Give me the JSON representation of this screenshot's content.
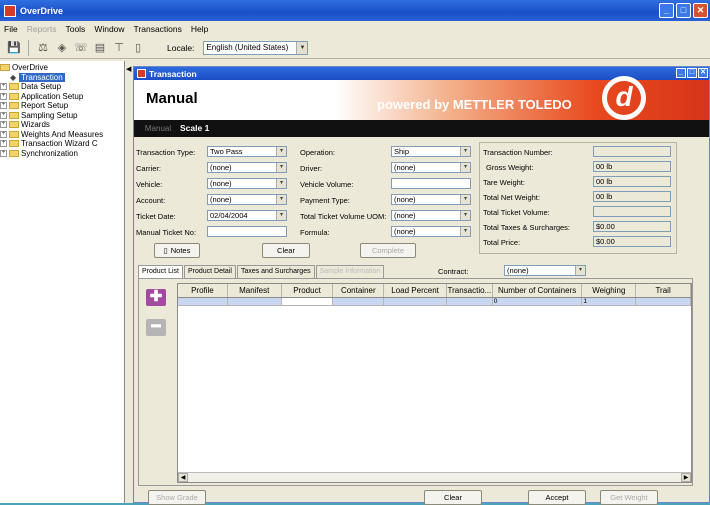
{
  "app": {
    "title": "OverDrive"
  },
  "menu": [
    "File",
    "Reports",
    "Tools",
    "Window",
    "Transactions",
    "Help"
  ],
  "locale": {
    "label": "Locale:",
    "value": "English (United States)"
  },
  "tree": {
    "root": "OverDrive",
    "selected": "Transaction",
    "items": [
      "Data Setup",
      "Application Setup",
      "Report Setup",
      "Sampling Setup",
      "Wizards",
      "Weights And Measures",
      "Transaction Wizard C",
      "Synchronization"
    ]
  },
  "child": {
    "title": "Transaction",
    "mode": "Manual",
    "brand": "powered by METTLER TOLEDO",
    "logo_letter": "d",
    "tab_inactive": "Manual",
    "scale": "Scale 1"
  },
  "form": {
    "transaction_type": {
      "label": "Transaction Type:",
      "value": "Two Pass"
    },
    "carrier": {
      "label": "Carrier:",
      "value": "(none)"
    },
    "vehicle": {
      "label": "Vehicle:",
      "value": "(none)"
    },
    "account": {
      "label": "Account:",
      "value": "(none)"
    },
    "ticket_date": {
      "label": "Ticket Date:",
      "value": "02/04/2004"
    },
    "manual_ticket": {
      "label": "Manual Ticket No:",
      "value": ""
    },
    "operation": {
      "label": "Operation:",
      "value": "Ship"
    },
    "driver": {
      "label": "Driver:",
      "value": "(none)"
    },
    "vehicle_volume": {
      "label": "Vehicle Volume:",
      "value": ""
    },
    "payment_type": {
      "label": "Payment Type:",
      "value": "(none)"
    },
    "total_ticket_volume_uom": {
      "label": "Total Ticket Volume UOM:",
      "value": "(none)"
    },
    "formula": {
      "label": "Formula:",
      "value": "(none)"
    }
  },
  "summary": {
    "transaction_number": {
      "label": "Transaction Number:",
      "value": ""
    },
    "gross_weight": {
      "label": "Gross Weight:",
      "value": "00 lb"
    },
    "tare_weight": {
      "label": "Tare Weight:",
      "value": "00 lb"
    },
    "total_net_weight": {
      "label": "Total Net Weight:",
      "value": "00 lb"
    },
    "total_ticket_volume": {
      "label": "Total Ticket Volume:",
      "value": ""
    },
    "total_taxes": {
      "label": "Total Taxes & Surcharges:",
      "value": "$0.00"
    },
    "total_price": {
      "label": "Total Price:",
      "value": "$0.00"
    }
  },
  "buttons": {
    "notes": "Notes",
    "clear_top": "Clear",
    "complete": "Complete",
    "show_grade": "Show Grade",
    "clear": "Clear",
    "accept": "Accept",
    "get_weight": "Get Weight"
  },
  "tabs": [
    "Product List",
    "Product Detail",
    "Taxes and Surcharges",
    "Sample Information"
  ],
  "contract": {
    "label": "Contract:",
    "value": "(none)"
  },
  "grid": {
    "columns": [
      "Profile",
      "Manifest",
      "Product",
      "Container",
      "Load Percent",
      "Transactio...",
      "Number of Containers",
      "Weighing",
      "Trail"
    ],
    "rows": [
      [
        "",
        "",
        "",
        "",
        "",
        "",
        "0",
        "1",
        ""
      ]
    ]
  }
}
